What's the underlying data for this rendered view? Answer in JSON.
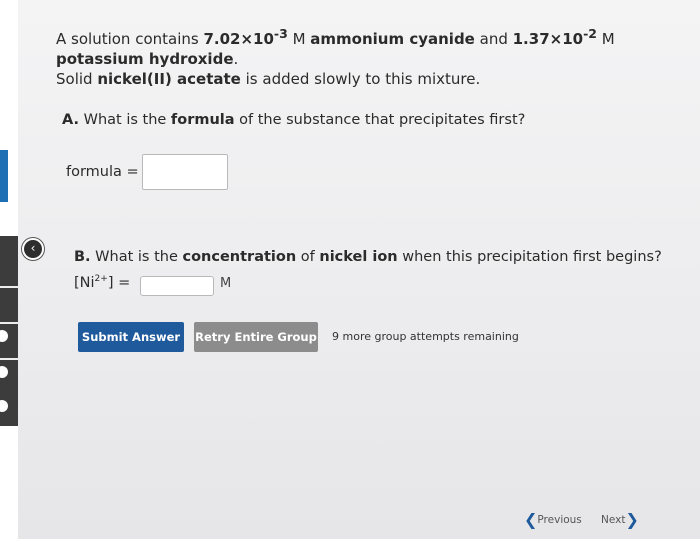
{
  "question": {
    "intro_1": "A solution contains ",
    "conc1_mantissa": "7.02×10",
    "conc1_exp": "-3",
    "conc1_unit": " M ",
    "compound1": "ammonium cyanide",
    "and": " and ",
    "conc2_mantissa": "1.37×10",
    "conc2_exp": "-2",
    "conc2_unit": " M ",
    "compound2": "potassium hydroxide",
    "period": ".",
    "line2_start": "Solid ",
    "added_compound": "nickel(II) acetate",
    "line2_end": " is added slowly to this mixture."
  },
  "part_a": {
    "prefix": "A.",
    "text_1": " What is the ",
    "bold": "formula",
    "text_2": " of the substance that precipitates first?",
    "input_label": "formula =",
    "input_value": ""
  },
  "part_b": {
    "prefix": "B.",
    "text_1": " What is the ",
    "bold_1": "concentration",
    "text_2": " of ",
    "bold_2": "nickel ion",
    "text_3": " when this precipitation first begins?",
    "label_open": "[Ni",
    "label_sup": "2+",
    "label_close": "] =",
    "input_value": "",
    "unit": "M"
  },
  "buttons": {
    "submit": "Submit Answer",
    "retry": "Retry Entire Group",
    "attempts": "9 more group attempts remaining"
  },
  "nav": {
    "previous": "Previous",
    "next": "Next"
  },
  "colors": {
    "primary_button": "#1e5a9c",
    "secondary_button": "#8c8c8c"
  },
  "icons": {
    "back": "back-arrow-icon",
    "prev": "chevron-left-icon",
    "next": "chevron-right-icon"
  }
}
